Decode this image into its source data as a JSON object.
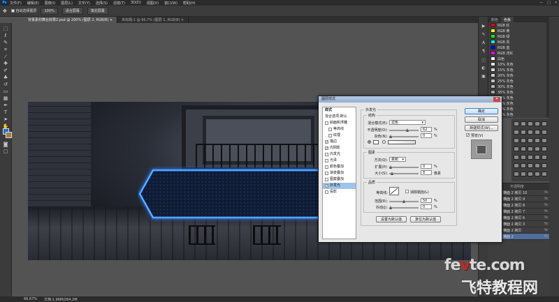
{
  "app": {
    "logo": "Ps"
  },
  "menu": [
    "文件(F)",
    "编辑(E)",
    "图像(I)",
    "图层(L)",
    "文字(Y)",
    "选择(S)",
    "滤镜(T)",
    "3D(D)",
    "视图(V)",
    "窗口(W)",
    "帮助(H)"
  ],
  "window_controls": [
    "—",
    "□",
    "✕"
  ],
  "options_bar": {
    "tool_icon": "move-tool-icon",
    "auto_select": "自动选择图层",
    "buttons": [
      "100%",
      "适合屏幕",
      "填充屏幕"
    ]
  },
  "tabs": [
    {
      "label": "背景素材舞台效果2.psd @ 200% (图层 2, RGB/8) ×",
      "active": true
    },
    {
      "label": "未标题-1 @ 66.7% (图层 1, RGB/8) ×",
      "active": false
    }
  ],
  "status": {
    "zoom": "66.67%",
    "doc": "文档:1.96M/264.2M"
  },
  "swatches": {
    "tabs": [
      "颜色",
      "色板"
    ],
    "items": [
      {
        "name": "RGB 红",
        "color": "#ff0000"
      },
      {
        "name": "RGB 黄",
        "color": "#ffff00"
      },
      {
        "name": "RGB 绿",
        "color": "#00ff00"
      },
      {
        "name": "RGB 青",
        "color": "#00ffff"
      },
      {
        "name": "RGB 蓝",
        "color": "#0000ff"
      },
      {
        "name": "RGB 洋红",
        "color": "#ff00ff"
      },
      {
        "name": "白色",
        "color": "#ffffff"
      },
      {
        "name": "10% 灰色",
        "color": "#e6e6e6"
      },
      {
        "name": "15% 灰色",
        "color": "#d9d9d9"
      },
      {
        "name": "20% 灰色",
        "color": "#cccccc"
      },
      {
        "name": "25% 灰色",
        "color": "#bfbfbf"
      },
      {
        "name": "30% 灰色",
        "color": "#b3b3b3"
      },
      {
        "name": "35% 灰色",
        "color": "#a6a6a6"
      },
      {
        "name": "40% 灰色",
        "color": "#999999"
      },
      {
        "name": "45% 灰色",
        "color": "#8c8c8c"
      },
      {
        "name": "50% 灰色",
        "color": "#808080"
      },
      {
        "name": "55% 灰色",
        "color": "#737373"
      }
    ]
  },
  "layers": {
    "header": "不透明度",
    "items": [
      {
        "name": "横面 2 拷贝 10",
        "fx": "fx",
        "selected": false
      },
      {
        "name": "横面 2 拷贝 9",
        "fx": "fx",
        "selected": false
      },
      {
        "name": "横面 2 拷贝 8",
        "fx": "fx",
        "selected": false
      },
      {
        "name": "横面 2 拷贝 7",
        "fx": "fx",
        "selected": false
      },
      {
        "name": "横面 2 拷贝 6",
        "fx": "fx",
        "selected": false
      },
      {
        "name": "横面 2 拷贝 3",
        "fx": "fx",
        "selected": false
      },
      {
        "name": "横面 2 拷贝",
        "fx": "fx",
        "selected": false
      },
      {
        "name": "横面 2",
        "fx": "fx",
        "selected": true
      }
    ]
  },
  "dialog": {
    "title": "图层样式",
    "close": "✕",
    "nav": [
      {
        "label": "样式",
        "checkbox": false,
        "checked": false,
        "indent": false,
        "selected": false
      },
      {
        "label": "混合选项:默认",
        "checkbox": false,
        "checked": false,
        "indent": false,
        "selected": false
      },
      {
        "label": "斜面和浮雕",
        "checkbox": true,
        "checked": false,
        "indent": false,
        "selected": false
      },
      {
        "label": "等高线",
        "checkbox": true,
        "checked": false,
        "indent": true,
        "selected": false
      },
      {
        "label": "纹理",
        "checkbox": true,
        "checked": false,
        "indent": true,
        "selected": false
      },
      {
        "label": "描边",
        "checkbox": true,
        "checked": true,
        "indent": false,
        "selected": false
      },
      {
        "label": "内阴影",
        "checkbox": true,
        "checked": true,
        "indent": false,
        "selected": false
      },
      {
        "label": "内发光",
        "checkbox": true,
        "checked": false,
        "indent": false,
        "selected": false
      },
      {
        "label": "光泽",
        "checkbox": true,
        "checked": false,
        "indent": false,
        "selected": false
      },
      {
        "label": "颜色叠加",
        "checkbox": true,
        "checked": false,
        "indent": false,
        "selected": false
      },
      {
        "label": "渐变叠加",
        "checkbox": true,
        "checked": false,
        "indent": false,
        "selected": false
      },
      {
        "label": "图案叠加",
        "checkbox": true,
        "checked": false,
        "indent": false,
        "selected": false
      },
      {
        "label": "外发光",
        "checkbox": true,
        "checked": true,
        "indent": false,
        "selected": true
      },
      {
        "label": "投影",
        "checkbox": true,
        "checked": false,
        "indent": false,
        "selected": false
      }
    ],
    "section_title": "外发光",
    "structure": {
      "title": "结构",
      "blend_label": "混合模式(E):",
      "blend_value": "滤色",
      "opacity_label": "不透明度(O):",
      "opacity_value": "62",
      "noise_label": "杂色(N):",
      "noise_value": "0",
      "unit": "%"
    },
    "elements": {
      "title": "图素",
      "method_label": "方法(Q):",
      "method_value": "柔和",
      "spread_label": "扩展(P):",
      "spread_value": "0",
      "size_label": "大小(S):",
      "size_value": "8",
      "pct": "%",
      "px": "像素"
    },
    "quality": {
      "title": "品质",
      "contour_label": "等高线:",
      "antialias": "消除锯齿(L)",
      "range_label": "范围(R):",
      "range_value": "50",
      "jitter_label": "抖动(J):",
      "jitter_value": "0",
      "unit": "%"
    },
    "defaults": [
      "设置为默认值",
      "复位为默认值"
    ],
    "buttons": {
      "ok": "确定",
      "cancel": "取消",
      "new_style": "新建样式(W)...",
      "preview": "预览(V)"
    }
  },
  "watermark": {
    "line1_a": "fe",
    "line1_b": "v",
    "line1_c": "te.com",
    "line2": "飞特教程网"
  },
  "colors": {
    "accent": "#31a8ff",
    "glow": "#1e73ff",
    "panel": "#3e3e3e",
    "dialog": "#e7e7e7"
  }
}
